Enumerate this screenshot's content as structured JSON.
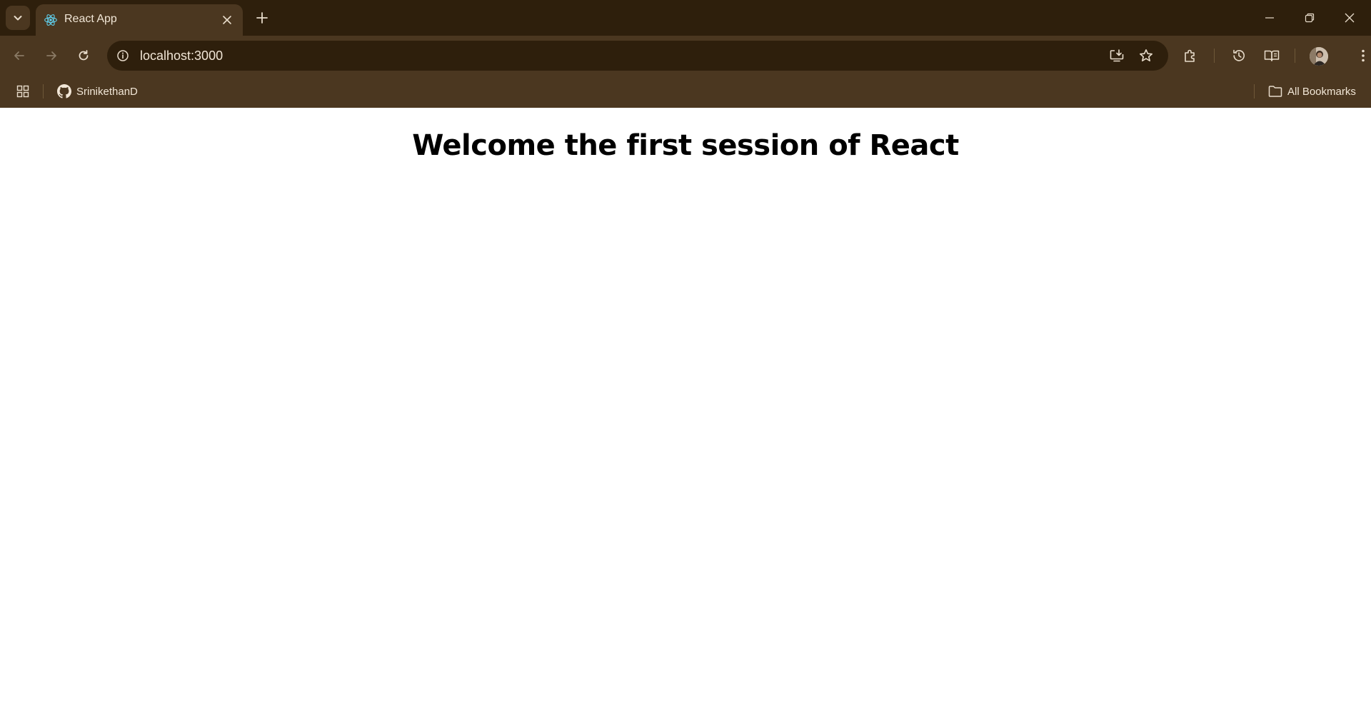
{
  "browser": {
    "tab": {
      "title": "React App",
      "favicon": "react-logo-icon"
    },
    "address_bar": {
      "url": "localhost:3000"
    },
    "bookmarks": {
      "items": [
        {
          "label": "SrinikethanD",
          "icon": "github-icon"
        }
      ],
      "all_bookmarks_label": "All Bookmarks"
    },
    "colors": {
      "frame_dark": "#2e1f0c",
      "frame_toolbar": "#4b3720",
      "icon_tint": "#e8dccb",
      "react_accent": "#61dafb"
    }
  },
  "page": {
    "heading": "Welcome the first session of React"
  }
}
